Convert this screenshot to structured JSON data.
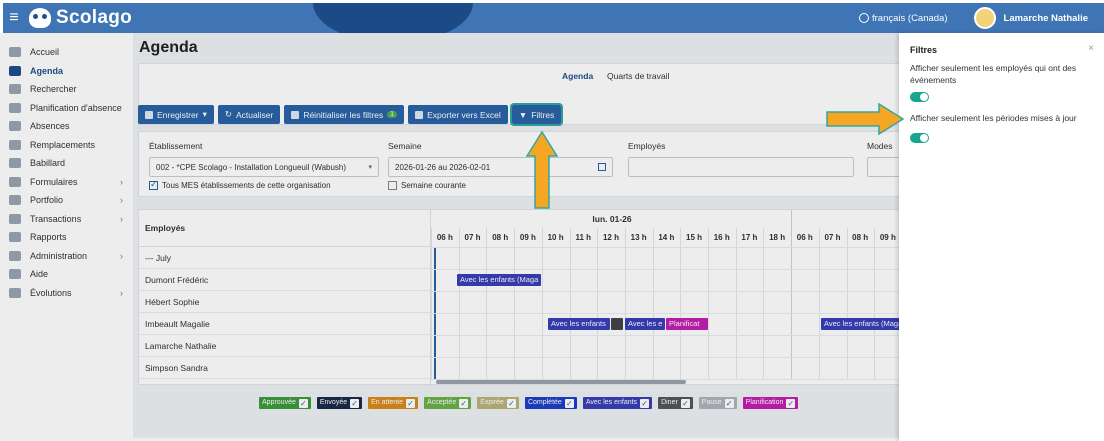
{
  "app": {
    "name": "Scolago"
  },
  "header": {
    "language": "français (Canada)",
    "user": "Lamarche Nathalie"
  },
  "sidebar": {
    "items": [
      {
        "label": "Accueil",
        "icon": "home-icon",
        "chevron": false
      },
      {
        "label": "Agenda",
        "icon": "calendar-icon",
        "chevron": false,
        "active": true
      },
      {
        "label": "Rechercher",
        "icon": "search-icon",
        "chevron": false
      },
      {
        "label": "Planification d'absence",
        "icon": "calendar-plan-icon",
        "chevron": false
      },
      {
        "label": "Absences",
        "icon": "user-absence-icon",
        "chevron": false
      },
      {
        "label": "Remplacements",
        "icon": "replace-icon",
        "chevron": false
      },
      {
        "label": "Babillard",
        "icon": "board-icon",
        "chevron": false
      },
      {
        "label": "Formulaires",
        "icon": "form-icon",
        "chevron": true
      },
      {
        "label": "Portfolio",
        "icon": "trophy-icon",
        "chevron": true
      },
      {
        "label": "Transactions",
        "icon": "transaction-icon",
        "chevron": true
      },
      {
        "label": "Rapports",
        "icon": "report-icon",
        "chevron": false
      },
      {
        "label": "Administration",
        "icon": "gear-icon",
        "chevron": true
      },
      {
        "label": "Aide",
        "icon": "help-icon",
        "chevron": false
      },
      {
        "label": "Évolutions",
        "icon": "evolution-icon",
        "chevron": true
      }
    ]
  },
  "page": {
    "title": "Agenda"
  },
  "tabs": [
    {
      "label": "Agenda",
      "active": true
    },
    {
      "label": "Quarts de travail",
      "active": false
    }
  ],
  "toolbar": {
    "save": "Enregistrer",
    "refresh": "Actualiser",
    "reset": "Réinitialiser les filtres",
    "reset_badge": "1",
    "export": "Exporter vers Excel",
    "filters": "Filtres"
  },
  "filters": {
    "etablissement_label": "Établissement",
    "etablissement_value": "002 - *CPE Scolago - Installation Longueuil (Wabush)",
    "all_label": "Tous MES établissements de cette organisation",
    "semaine_label": "Semaine",
    "semaine_value": "2026-01-26 au 2026-02-01",
    "courante_label": "Semaine courante",
    "employes_label": "Employés",
    "modes_label": "Modes"
  },
  "grid": {
    "employees_header": "Employés",
    "day": "lun. 01-26",
    "hours": [
      "06 h",
      "07 h",
      "08 h",
      "09 h",
      "10 h",
      "11 h",
      "12 h",
      "13 h",
      "14 h",
      "15 h",
      "16 h",
      "17 h",
      "18 h",
      "06 h",
      "07 h",
      "08 h",
      "09 h"
    ],
    "employees": [
      "--- July",
      "Dumont Frédéric",
      "Hébert Sophie",
      "Imbeault Magalie",
      "Lamarche Nathalie",
      "Simpson Sandra"
    ],
    "events": [
      {
        "text": "Avec les enfants (Maga",
        "row": 1,
        "color": "#3a3fb8"
      },
      {
        "text": "Avec les enfants",
        "row": 3,
        "color": "#3a3fb8"
      },
      {
        "text": "",
        "row": 3,
        "color": "#444444"
      },
      {
        "text": "Avec les e",
        "row": 3,
        "color": "#3a3fb8"
      },
      {
        "text": "Planificat",
        "row": 3,
        "color": "#c21fb0"
      },
      {
        "text": "Avec les enfants (Maga",
        "row": 3,
        "color": "#3a3fb8"
      }
    ]
  },
  "legend": [
    {
      "label": "Approuvée",
      "color": "#3c9a3c"
    },
    {
      "label": "Envoyée",
      "color": "#1c2b4a"
    },
    {
      "label": "En attente",
      "color": "#d98a1c"
    },
    {
      "label": "Acceptée",
      "color": "#6bb04a"
    },
    {
      "label": "Expirée",
      "color": "#b8b27a"
    },
    {
      "label": "Complétée",
      "color": "#1c3fc8"
    },
    {
      "label": "Avec les enfants",
      "color": "#3a3fb8"
    },
    {
      "label": "Diner",
      "color": "#555555"
    },
    {
      "label": "Pause",
      "color": "#b0b4bb"
    },
    {
      "label": "Planification",
      "color": "#c21fb0"
    }
  ],
  "panel": {
    "title": "Filtres",
    "close": "×",
    "option1": "Afficher seulement les employés qui ont des événements",
    "option1_on": true,
    "option2": "Afficher seulement les périodes mises à jour",
    "option2_on": true
  },
  "colors": {
    "brand": "#3f74b5",
    "button": "#2b64a8",
    "toggle": "#17a58d",
    "arrow": "#f5a623"
  }
}
